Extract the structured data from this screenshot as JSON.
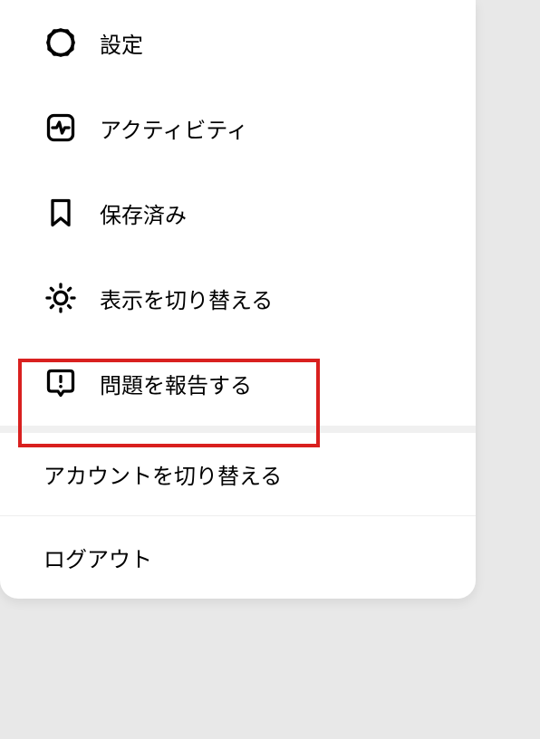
{
  "menu": {
    "items": [
      {
        "label": "設定",
        "icon": "gear"
      },
      {
        "label": "アクティビティ",
        "icon": "activity"
      },
      {
        "label": "保存済み",
        "icon": "bookmark"
      },
      {
        "label": "表示を切り替える",
        "icon": "sun"
      },
      {
        "label": "問題を報告する",
        "icon": "alert"
      }
    ],
    "switch_account_label": "アカウントを切り替える",
    "logout_label": "ログアウト"
  }
}
